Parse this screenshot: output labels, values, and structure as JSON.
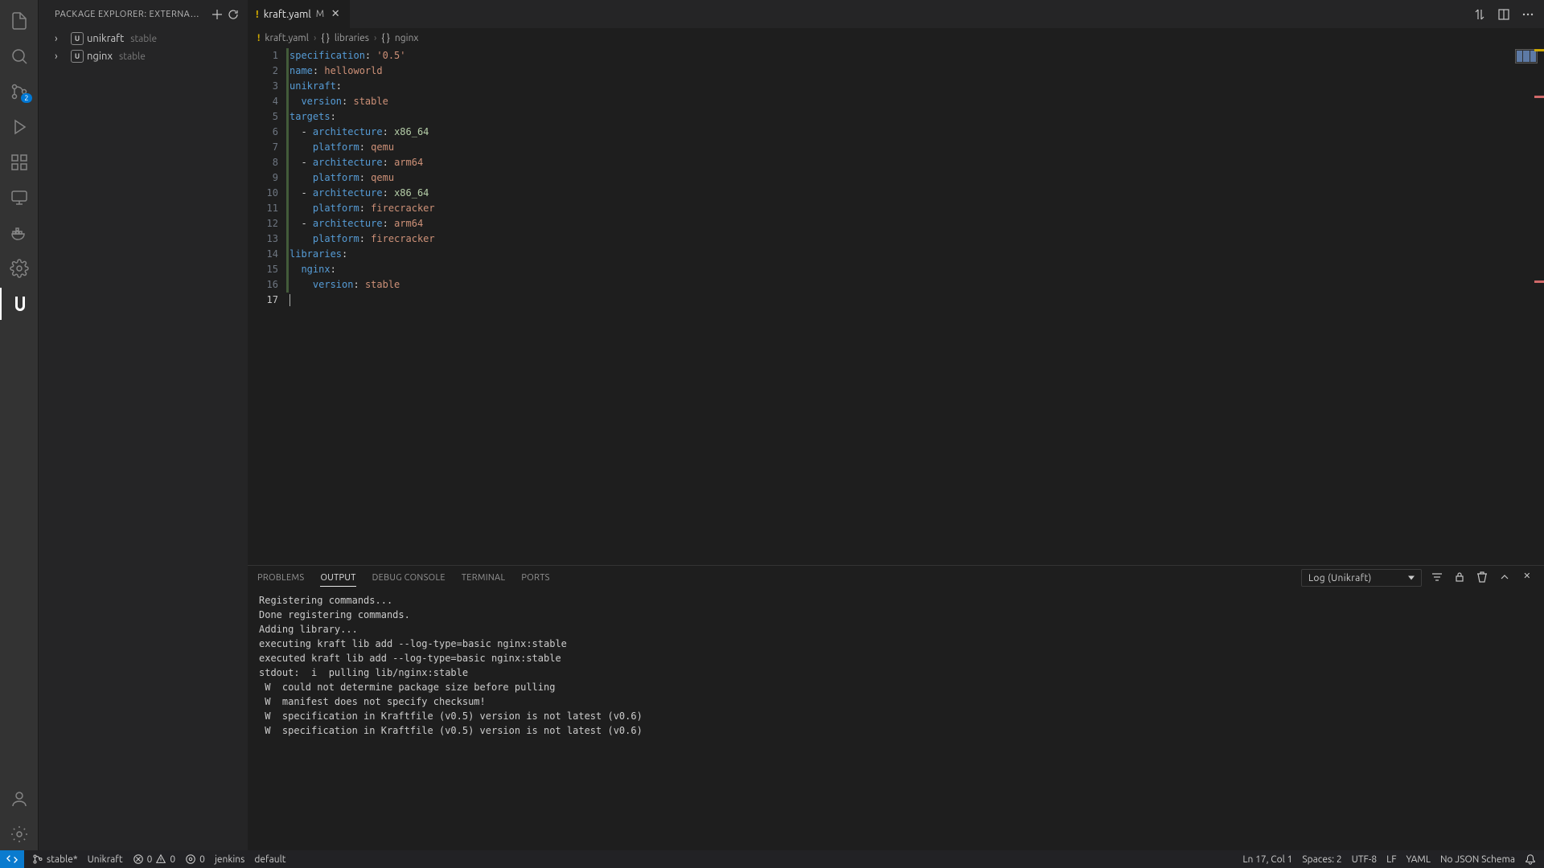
{
  "sidebar": {
    "header_title": "PACKAGE EXPLORER: EXTERNA…",
    "items": [
      {
        "label": "unikraft",
        "muted": "stable"
      },
      {
        "label": "nginx",
        "muted": "stable"
      }
    ]
  },
  "scm_badge": "2",
  "tab": {
    "filename": "kraft.yaml",
    "modified_marker": "M"
  },
  "breadcrumb": {
    "file": "kraft.yaml",
    "seg1": "libraries",
    "seg2": "nginx"
  },
  "editor": {
    "lines": [
      {
        "n": 1,
        "tokens": [
          {
            "t": "specification",
            "c": "k"
          },
          {
            "t": ": ",
            "c": "p"
          },
          {
            "t": "'0.5'",
            "c": "v"
          }
        ]
      },
      {
        "n": 2,
        "tokens": [
          {
            "t": "name",
            "c": "k"
          },
          {
            "t": ": ",
            "c": "p"
          },
          {
            "t": "helloworld",
            "c": "v"
          }
        ]
      },
      {
        "n": 3,
        "tokens": [
          {
            "t": "unikraft",
            "c": "k"
          },
          {
            "t": ":",
            "c": "p"
          }
        ]
      },
      {
        "n": 4,
        "indent": 2,
        "tokens": [
          {
            "t": "version",
            "c": "k"
          },
          {
            "t": ": ",
            "c": "p"
          },
          {
            "t": "stable",
            "c": "v"
          }
        ]
      },
      {
        "n": 5,
        "tokens": [
          {
            "t": "targets",
            "c": "k"
          },
          {
            "t": ":",
            "c": "p"
          }
        ]
      },
      {
        "n": 6,
        "indent": 2,
        "tokens": [
          {
            "t": "- ",
            "c": "p"
          },
          {
            "t": "architecture",
            "c": "k"
          },
          {
            "t": ": ",
            "c": "p"
          },
          {
            "t": "x86_64",
            "c": "n"
          }
        ]
      },
      {
        "n": 7,
        "indent": 4,
        "tokens": [
          {
            "t": "platform",
            "c": "k"
          },
          {
            "t": ": ",
            "c": "p"
          },
          {
            "t": "qemu",
            "c": "v"
          }
        ]
      },
      {
        "n": 8,
        "indent": 2,
        "tokens": [
          {
            "t": "- ",
            "c": "p"
          },
          {
            "t": "architecture",
            "c": "k"
          },
          {
            "t": ": ",
            "c": "p"
          },
          {
            "t": "arm64",
            "c": "v"
          }
        ]
      },
      {
        "n": 9,
        "indent": 4,
        "tokens": [
          {
            "t": "platform",
            "c": "k"
          },
          {
            "t": ": ",
            "c": "p"
          },
          {
            "t": "qemu",
            "c": "v"
          }
        ]
      },
      {
        "n": 10,
        "indent": 2,
        "tokens": [
          {
            "t": "- ",
            "c": "p"
          },
          {
            "t": "architecture",
            "c": "k"
          },
          {
            "t": ": ",
            "c": "p"
          },
          {
            "t": "x86_64",
            "c": "n"
          }
        ]
      },
      {
        "n": 11,
        "indent": 4,
        "tokens": [
          {
            "t": "platform",
            "c": "k"
          },
          {
            "t": ": ",
            "c": "p"
          },
          {
            "t": "firecracker",
            "c": "v"
          }
        ]
      },
      {
        "n": 12,
        "indent": 2,
        "tokens": [
          {
            "t": "- ",
            "c": "p"
          },
          {
            "t": "architecture",
            "c": "k"
          },
          {
            "t": ": ",
            "c": "p"
          },
          {
            "t": "arm64",
            "c": "v"
          }
        ]
      },
      {
        "n": 13,
        "indent": 4,
        "tokens": [
          {
            "t": "platform",
            "c": "k"
          },
          {
            "t": ": ",
            "c": "p"
          },
          {
            "t": "firecracker",
            "c": "v"
          }
        ]
      },
      {
        "n": 14,
        "tokens": [
          {
            "t": "libraries",
            "c": "k"
          },
          {
            "t": ":",
            "c": "p"
          }
        ]
      },
      {
        "n": 15,
        "indent": 2,
        "tokens": [
          {
            "t": "nginx",
            "c": "k"
          },
          {
            "t": ":",
            "c": "p"
          }
        ]
      },
      {
        "n": 16,
        "indent": 4,
        "tokens": [
          {
            "t": "version",
            "c": "k"
          },
          {
            "t": ": ",
            "c": "p"
          },
          {
            "t": "stable",
            "c": "v"
          }
        ]
      },
      {
        "n": 17,
        "active": true,
        "tokens": [
          {
            "t": "",
            "c": "p"
          }
        ],
        "cursor": true
      }
    ],
    "git_added_ranges": [
      [
        1,
        13
      ],
      [
        14,
        16
      ]
    ]
  },
  "panel": {
    "tabs": [
      "PROBLEMS",
      "OUTPUT",
      "DEBUG CONSOLE",
      "TERMINAL",
      "PORTS"
    ],
    "active_tab": 1,
    "channel": "Log (Unikraft)",
    "output": [
      "Registering commands...",
      "Done registering commands.",
      "Adding library...",
      "executing kraft lib add --log-type=basic nginx:stable",
      "executed kraft lib add --log-type=basic nginx:stable",
      "stdout:  i  pulling lib/nginx:stable",
      " W  could not determine package size before pulling",
      " W  manifest does not specify checksum!",
      " W  specification in Kraftfile (v0.5) version is not latest (v0.6)",
      " W  specification in Kraftfile (v0.5) version is not latest (v0.6)"
    ]
  },
  "status": {
    "branch": "stable*",
    "project": "Unikraft",
    "errors": "0",
    "warnings": "0",
    "ports": "0",
    "user": "jenkins",
    "context": "default",
    "cursor": "Ln 17, Col 1",
    "spaces": "Spaces: 2",
    "encoding": "UTF-8",
    "eol": "LF",
    "language": "YAML",
    "schema": "No JSON Schema"
  }
}
